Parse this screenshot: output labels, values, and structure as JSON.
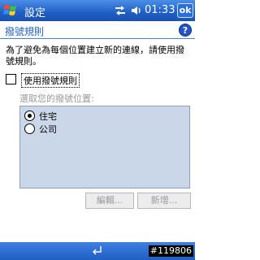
{
  "titlebar": {
    "app_title": "設定",
    "clock": "01:33",
    "ok_label": "ok",
    "icons": [
      "windows-start-icon",
      "signal-icon",
      "volume-icon"
    ]
  },
  "header": {
    "title": "撥號規則",
    "help_label": "?"
  },
  "description": "為了避免為每個位置建立新的連線，請使用撥號規則。",
  "use_rules": {
    "label": "使用撥號規則",
    "checked": false
  },
  "location_section_label": "選取您的撥號位置:",
  "locations": [
    {
      "label": "住宅",
      "selected": true
    },
    {
      "label": "公司",
      "selected": false
    }
  ],
  "buttons": {
    "edit_label": "編輯...",
    "new_label": "新增..."
  },
  "watermark": "#119806",
  "colors": {
    "titlebar": "#1f5fc4",
    "header_text": "#1f5fc4",
    "list_bg": "#c9d7e8",
    "disabled_text": "#9a9a9a"
  }
}
